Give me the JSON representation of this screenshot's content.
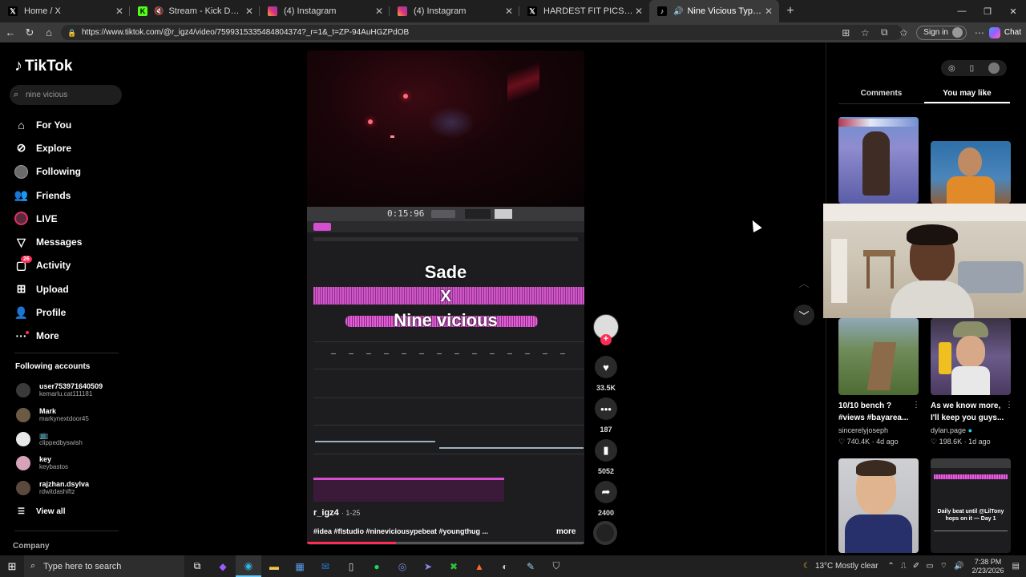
{
  "browser": {
    "tabs": [
      {
        "title": "Home / X",
        "favicon": "x-logo-icon",
        "active": false
      },
      {
        "title": "Stream - Kick Dashboard",
        "favicon": "kick-logo-icon",
        "active": false,
        "muted": true
      },
      {
        "title": "(4) Instagram",
        "favicon": "instagram-icon",
        "active": false
      },
      {
        "title": "(4) Instagram",
        "favicon": "instagram-icon",
        "active": false
      },
      {
        "title": "HARDEST FIT PICS on X: \"Supreme",
        "favicon": "x-logo-icon",
        "active": false
      },
      {
        "title": "Nine Vicious Type Beat Collab",
        "favicon": "tiktok-icon",
        "active": true,
        "audio": true
      }
    ],
    "url": "https://www.tiktok.com/@r_igz4/video/7599315335484804374?_r=1&_t=ZP-94AuHGZPdOB",
    "sign_in": "Sign in",
    "chat": "Chat"
  },
  "tiktok": {
    "brand": "TikTok",
    "search_placeholder": "nine vicious",
    "nav": [
      {
        "label": "For You",
        "icon": "home-icon"
      },
      {
        "label": "Explore",
        "icon": "compass-icon"
      },
      {
        "label": "Following",
        "icon": "avatar-icon"
      },
      {
        "label": "Friends",
        "icon": "friends-icon"
      },
      {
        "label": "LIVE",
        "icon": "live-icon"
      },
      {
        "label": "Messages",
        "icon": "messages-icon"
      },
      {
        "label": "Activity",
        "icon": "activity-icon",
        "badge": "26"
      },
      {
        "label": "Upload",
        "icon": "upload-icon"
      },
      {
        "label": "Profile",
        "icon": "profile-icon"
      },
      {
        "label": "More",
        "icon": "more-icon"
      }
    ],
    "following_title": "Following accounts",
    "following": [
      {
        "name": "user753971640509",
        "handle": "kemarlu.cat111181",
        "color": "#3a3a3a"
      },
      {
        "name": "Mark",
        "handle": "markynextdoor45",
        "color": "#6b5a44"
      },
      {
        "name": "📺",
        "handle": "clippedbyswish",
        "color": "#e8e8e8"
      },
      {
        "name": "key",
        "handle": "keybastos",
        "color": "#d7a3b8"
      },
      {
        "name": "rajzhan.dsylva",
        "handle": "rdwitdashiftz",
        "color": "#5b4a3c"
      }
    ],
    "view_all": "View all",
    "company": "Company"
  },
  "video": {
    "time_display": "0:15:96",
    "overlay_line1": "Sade",
    "overlay_line2": "X",
    "overlay_line3": "Nine vicious",
    "author": "r_igz4",
    "date": "1-25",
    "tags": "#idea #flstudio #nineviciousypebeat #youngthug ...",
    "more": "more",
    "progress": 0.32
  },
  "actions": {
    "likes": "33.5K",
    "comments": "187",
    "saves": "5052",
    "shares": "2400"
  },
  "side": {
    "tabs": [
      {
        "label": "Comments",
        "active": false
      },
      {
        "label": "You may like",
        "active": true
      }
    ],
    "cards": [
      {
        "caption": "10/10 bench ? #views #bayarea...",
        "user": "sincerelyjoseph",
        "views": "740.4K",
        "age": "4d ago"
      },
      {
        "caption": "As we know more, I'll keep you guys...",
        "user": "dylan.page",
        "verified": true,
        "views": "198.6K",
        "age": "1d ago"
      }
    ],
    "card4_caption": "Daily beat until @LilTony hops on it — Day 1"
  },
  "taskbar": {
    "search_placeholder": "Type here to search",
    "weather": "13°C  Mostly clear",
    "time": "7:38 PM",
    "date": "2/23/2026"
  }
}
